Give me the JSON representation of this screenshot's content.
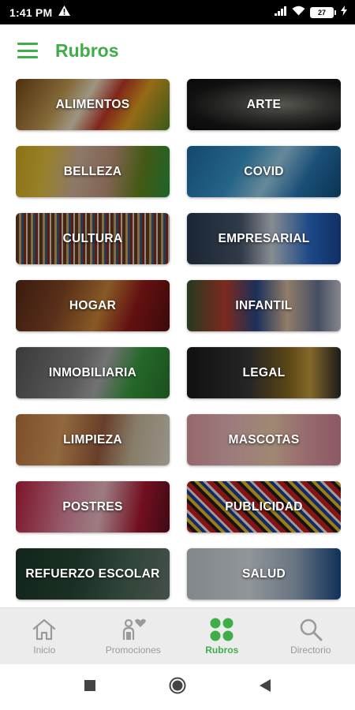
{
  "status_bar": {
    "time": "1:41 PM",
    "battery": "27"
  },
  "app_bar": {
    "title": "Rubros"
  },
  "colors": {
    "accent": "#3fae49",
    "nav_inactive": "#9a9a9a"
  },
  "categories": [
    {
      "label": "ALIMENTOS"
    },
    {
      "label": "ARTE"
    },
    {
      "label": "BELLEZA"
    },
    {
      "label": "COVID"
    },
    {
      "label": "CULTURA"
    },
    {
      "label": "EMPRESARIAL"
    },
    {
      "label": "HOGAR"
    },
    {
      "label": "INFANTIL"
    },
    {
      "label": "INMOBILIARIA"
    },
    {
      "label": "LEGAL"
    },
    {
      "label": "LIMPIEZA"
    },
    {
      "label": "MASCOTAS"
    },
    {
      "label": "POSTRES"
    },
    {
      "label": "PUBLICIDAD"
    },
    {
      "label": "REFUERZO ESCOLAR"
    },
    {
      "label": "SALUD"
    }
  ],
  "bottom_nav": [
    {
      "label": "Inicio",
      "icon": "home-icon"
    },
    {
      "label": "Promociones",
      "icon": "promotions-icon"
    },
    {
      "label": "Rubros",
      "icon": "grid-dots-icon",
      "active": true
    },
    {
      "label": "Directorio",
      "icon": "search-icon"
    }
  ]
}
